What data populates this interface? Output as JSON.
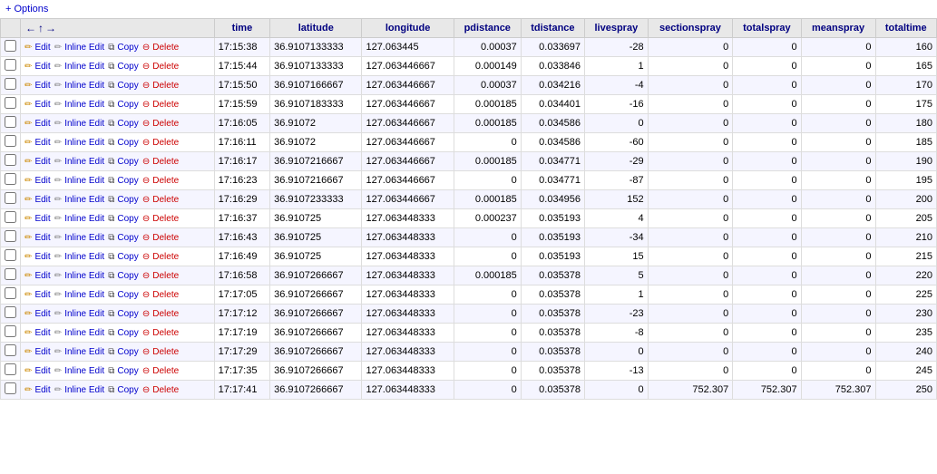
{
  "topbar": {
    "options_label": "+ Options"
  },
  "columns": [
    {
      "key": "check",
      "label": ""
    },
    {
      "key": "actions",
      "label": "←↑→"
    },
    {
      "key": "time",
      "label": "time"
    },
    {
      "key": "latitude",
      "label": "latitude"
    },
    {
      "key": "longitude",
      "label": "longitude"
    },
    {
      "key": "pdistance",
      "label": "pdistance"
    },
    {
      "key": "tdistance",
      "label": "tdistance"
    },
    {
      "key": "livespray",
      "label": "livespray"
    },
    {
      "key": "sectionspray",
      "label": "sectionspray"
    },
    {
      "key": "totalspray",
      "label": "totalspray"
    },
    {
      "key": "meanspray",
      "label": "meanspray"
    },
    {
      "key": "totaltime",
      "label": "totaltime"
    }
  ],
  "rows": [
    {
      "time": "17:15:38",
      "latitude": "36.9107133333",
      "longitude": "127.063445",
      "pdistance": "0.00037",
      "tdistance": "0.033697",
      "livespray": "-28",
      "sectionspray": "0",
      "totalspray": "0",
      "meanspray": "0",
      "totaltime": "160"
    },
    {
      "time": "17:15:44",
      "latitude": "36.9107133333",
      "longitude": "127.063446667",
      "pdistance": "0.000149",
      "tdistance": "0.033846",
      "livespray": "1",
      "sectionspray": "0",
      "totalspray": "0",
      "meanspray": "0",
      "totaltime": "165"
    },
    {
      "time": "17:15:50",
      "latitude": "36.9107166667",
      "longitude": "127.063446667",
      "pdistance": "0.00037",
      "tdistance": "0.034216",
      "livespray": "-4",
      "sectionspray": "0",
      "totalspray": "0",
      "meanspray": "0",
      "totaltime": "170"
    },
    {
      "time": "17:15:59",
      "latitude": "36.9107183333",
      "longitude": "127.063446667",
      "pdistance": "0.000185",
      "tdistance": "0.034401",
      "livespray": "-16",
      "sectionspray": "0",
      "totalspray": "0",
      "meanspray": "0",
      "totaltime": "175"
    },
    {
      "time": "17:16:05",
      "latitude": "36.91072",
      "longitude": "127.063446667",
      "pdistance": "0.000185",
      "tdistance": "0.034586",
      "livespray": "0",
      "sectionspray": "0",
      "totalspray": "0",
      "meanspray": "0",
      "totaltime": "180"
    },
    {
      "time": "17:16:11",
      "latitude": "36.91072",
      "longitude": "127.063446667",
      "pdistance": "0",
      "tdistance": "0.034586",
      "livespray": "-60",
      "sectionspray": "0",
      "totalspray": "0",
      "meanspray": "0",
      "totaltime": "185"
    },
    {
      "time": "17:16:17",
      "latitude": "36.9107216667",
      "longitude": "127.063446667",
      "pdistance": "0.000185",
      "tdistance": "0.034771",
      "livespray": "-29",
      "sectionspray": "0",
      "totalspray": "0",
      "meanspray": "0",
      "totaltime": "190"
    },
    {
      "time": "17:16:23",
      "latitude": "36.9107216667",
      "longitude": "127.063446667",
      "pdistance": "0",
      "tdistance": "0.034771",
      "livespray": "-87",
      "sectionspray": "0",
      "totalspray": "0",
      "meanspray": "0",
      "totaltime": "195"
    },
    {
      "time": "17:16:29",
      "latitude": "36.9107233333",
      "longitude": "127.063446667",
      "pdistance": "0.000185",
      "tdistance": "0.034956",
      "livespray": "152",
      "sectionspray": "0",
      "totalspray": "0",
      "meanspray": "0",
      "totaltime": "200"
    },
    {
      "time": "17:16:37",
      "latitude": "36.910725",
      "longitude": "127.063448333",
      "pdistance": "0.000237",
      "tdistance": "0.035193",
      "livespray": "4",
      "sectionspray": "0",
      "totalspray": "0",
      "meanspray": "0",
      "totaltime": "205"
    },
    {
      "time": "17:16:43",
      "latitude": "36.910725",
      "longitude": "127.063448333",
      "pdistance": "0",
      "tdistance": "0.035193",
      "livespray": "-34",
      "sectionspray": "0",
      "totalspray": "0",
      "meanspray": "0",
      "totaltime": "210"
    },
    {
      "time": "17:16:49",
      "latitude": "36.910725",
      "longitude": "127.063448333",
      "pdistance": "0",
      "tdistance": "0.035193",
      "livespray": "15",
      "sectionspray": "0",
      "totalspray": "0",
      "meanspray": "0",
      "totaltime": "215"
    },
    {
      "time": "17:16:58",
      "latitude": "36.9107266667",
      "longitude": "127.063448333",
      "pdistance": "0.000185",
      "tdistance": "0.035378",
      "livespray": "5",
      "sectionspray": "0",
      "totalspray": "0",
      "meanspray": "0",
      "totaltime": "220"
    },
    {
      "time": "17:17:05",
      "latitude": "36.9107266667",
      "longitude": "127.063448333",
      "pdistance": "0",
      "tdistance": "0.035378",
      "livespray": "1",
      "sectionspray": "0",
      "totalspray": "0",
      "meanspray": "0",
      "totaltime": "225"
    },
    {
      "time": "17:17:12",
      "latitude": "36.9107266667",
      "longitude": "127.063448333",
      "pdistance": "0",
      "tdistance": "0.035378",
      "livespray": "-23",
      "sectionspray": "0",
      "totalspray": "0",
      "meanspray": "0",
      "totaltime": "230"
    },
    {
      "time": "17:17:19",
      "latitude": "36.9107266667",
      "longitude": "127.063448333",
      "pdistance": "0",
      "tdistance": "0.035378",
      "livespray": "-8",
      "sectionspray": "0",
      "totalspray": "0",
      "meanspray": "0",
      "totaltime": "235"
    },
    {
      "time": "17:17:29",
      "latitude": "36.9107266667",
      "longitude": "127.063448333",
      "pdistance": "0",
      "tdistance": "0.035378",
      "livespray": "0",
      "sectionspray": "0",
      "totalspray": "0",
      "meanspray": "0",
      "totaltime": "240"
    },
    {
      "time": "17:17:35",
      "latitude": "36.9107266667",
      "longitude": "127.063448333",
      "pdistance": "0",
      "tdistance": "0.035378",
      "livespray": "-13",
      "sectionspray": "0",
      "totalspray": "0",
      "meanspray": "0",
      "totaltime": "245"
    },
    {
      "time": "17:17:41",
      "latitude": "36.9107266667",
      "longitude": "127.063448333",
      "pdistance": "0",
      "tdistance": "0.035378",
      "livespray": "0",
      "sectionspray": "752.307",
      "totalspray": "752.307",
      "meanspray": "752.307",
      "totaltime": "250"
    }
  ],
  "actions": {
    "edit": "Edit",
    "inline_edit": "Inline Edit",
    "copy": "Copy",
    "delete": "Delete"
  }
}
